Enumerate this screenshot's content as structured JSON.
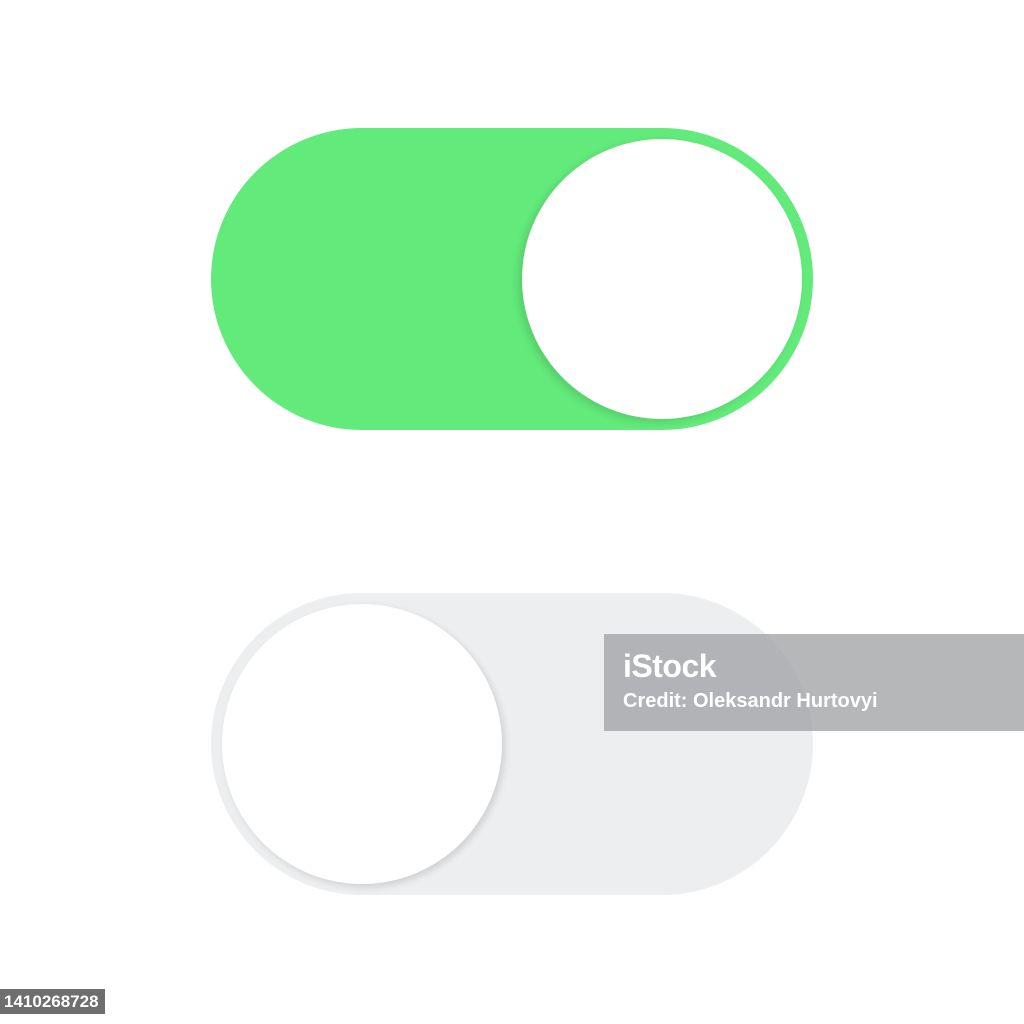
{
  "toggles": [
    {
      "state": "on",
      "track_color": "#62ea7a",
      "knob_color": "#ffffff",
      "knob_position": "right"
    },
    {
      "state": "off",
      "track_color": "#eceeef",
      "knob_color": "#ffffff",
      "knob_position": "left"
    }
  ],
  "watermark": {
    "brand": "iStock",
    "credit": "Credit: Oleksandr Hurtovyi"
  },
  "stock_id": "1410268728"
}
